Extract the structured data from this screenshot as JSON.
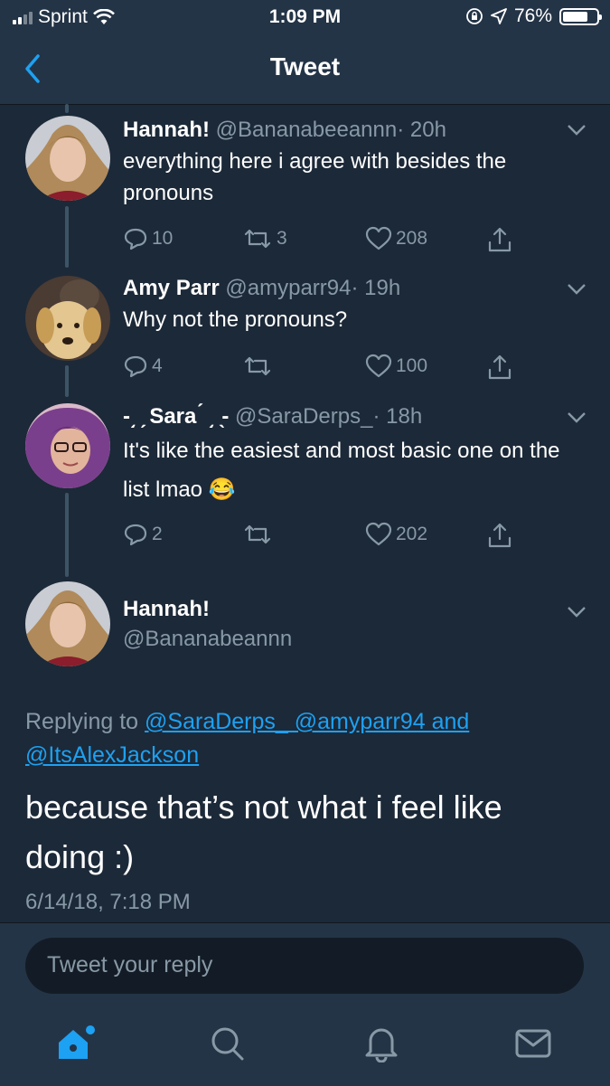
{
  "status_bar": {
    "carrier": "Sprint",
    "time": "1:09 PM",
    "battery": "76%",
    "battery_level": 0.76
  },
  "header": {
    "title": "Tweet"
  },
  "tweets": [
    {
      "name": "Hannah!",
      "handle": "@Bananabeeannn",
      "time": "· 20h",
      "text": "everything here i agree with besides the pronouns",
      "replies": "10",
      "retweets": "3",
      "likes": "208"
    },
    {
      "name": "Amy Parr",
      "handle": "@amyparr94",
      "time": "· 19h",
      "text": "Why not the pronouns?",
      "replies": "4",
      "retweets": "",
      "likes": "100"
    },
    {
      "name": "-͵ ̗ Sara ́ ͵ ̖-",
      "handle": "@SaraDerps_",
      "time": "· 18h",
      "text": "It's like the easiest and most basic one on the list lmao 😂",
      "replies": "2",
      "retweets": "",
      "likes": "202"
    }
  ],
  "focused_tweet": {
    "name": "Hannah!",
    "handle": "@Bananabeannn",
    "replying_prefix": "Replying to ",
    "replying_to": "@SaraDerps_ @amyparr94 and @ItsAlexJackson",
    "text": "because that’s not what i feel like doing :)",
    "timestamp": "6/14/18, 7:18 PM"
  },
  "compose": {
    "placeholder": "Tweet your reply"
  },
  "tabs": [
    "home-icon",
    "search-icon",
    "notifications-icon",
    "messages-icon"
  ],
  "colors": {
    "background": "#1c2938",
    "bar": "#243447",
    "accent": "#1da1f2",
    "muted": "#8899a6"
  }
}
